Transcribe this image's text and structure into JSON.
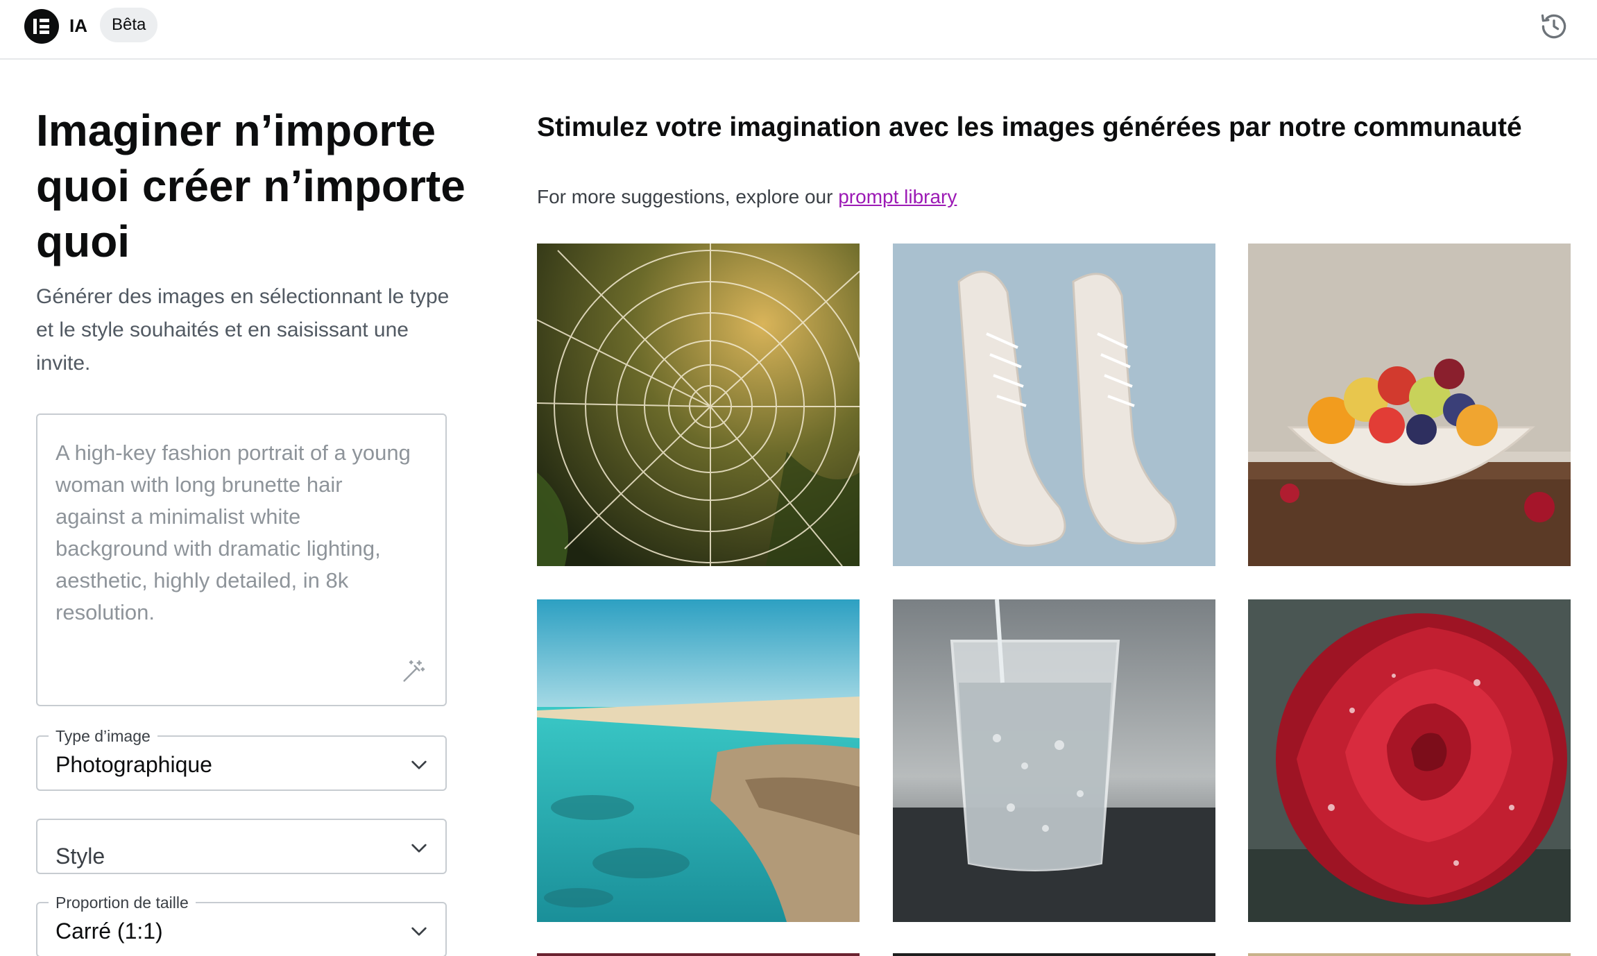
{
  "header": {
    "logo_icon": "elementor-logo-icon",
    "brand": "IA",
    "badge": "Bêta",
    "history_icon": "history-icon"
  },
  "left": {
    "headline": "Imaginer n’importe quoi créer n’importe quoi",
    "subtitle": "Générer des images en sélectionnant le type et le style souhaités et en saisissant une invite.",
    "prompt_placeholder": "A high-key fashion portrait of a young woman with long brunette hair against a minimalist white background with dramatic lighting, aesthetic, highly detailed, in 8k resolution.",
    "enhance_icon": "magic-wand-icon",
    "image_type": {
      "label": "Type d’image",
      "value": "Photographique"
    },
    "style": {
      "placeholder": "Style"
    },
    "aspect": {
      "label": "Proportion de taille",
      "value": "Carré (1:1)"
    }
  },
  "gallery": {
    "title": "Stimulez votre imagination avec les images générées par notre communauté",
    "suggest_text": "For more suggestions, explore our ",
    "suggest_link": "prompt library",
    "images": [
      "spider web with dew drops",
      "white sneakers on blue background",
      "fruit bowl on table",
      "turquoise beach and rocks",
      "glass of water being poured",
      "red rose with water drops"
    ]
  },
  "colors": {
    "link": "#9c1ab5",
    "text": "#0c0d0e",
    "muted": "#515962",
    "border": "#c7ccd1"
  }
}
